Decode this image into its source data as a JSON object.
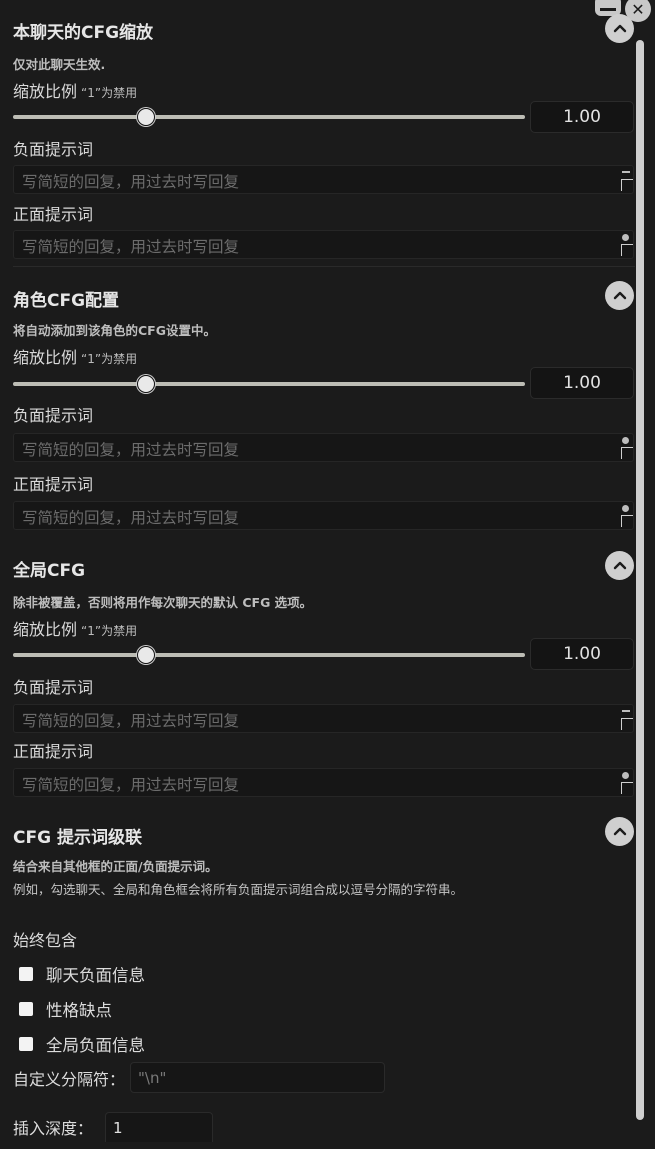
{
  "sections": [
    {
      "title": "本聊天的CFG缩放",
      "note": "仅对此聊天生效.",
      "scale_label": "缩放比例",
      "scale_hint": "“1”为禁用",
      "scale_value": "1.00",
      "scale_slider_fraction": 0.25,
      "negative_label": "负面提示词",
      "negative_placeholder": "写简短的回复，用过去时写回复",
      "positive_label": "正面提示词",
      "positive_placeholder": "写简短的回复，用过去时写回复"
    },
    {
      "title": "角色CFG配置",
      "note": "将自动添加到该角色的CFG设置中。",
      "scale_label": "缩放比例",
      "scale_hint": "“1”为禁用",
      "scale_value": "1.00",
      "scale_slider_fraction": 0.25,
      "negative_label": "负面提示词",
      "negative_placeholder": "写简短的回复，用过去时写回复",
      "positive_label": "正面提示词",
      "positive_placeholder": "写简短的回复，用过去时写回复"
    },
    {
      "title": "全局CFG",
      "note": "除非被覆盖，否则将用作每次聊天的默认 CFG 选项。",
      "scale_label": "缩放比例",
      "scale_hint": "“1”为禁用",
      "scale_value": "1.00",
      "scale_slider_fraction": 0.25,
      "negative_label": "负面提示词",
      "negative_placeholder": "写简短的回复，用过去时写回复",
      "positive_label": "正面提示词",
      "positive_placeholder": "写简短的回复，用过去时写回复"
    }
  ],
  "cascade": {
    "title": "CFG 提示词级联",
    "note1": "结合来自其他框的正面/负面提示词。",
    "note2": "例如，勾选聊天、全局和角色框会将所有负面提示词组合成以逗号分隔的字符串。",
    "always_include_label": "始终包含",
    "checkboxes": [
      {
        "label": "聊天负面信息",
        "checked": false
      },
      {
        "label": "性格缺点",
        "checked": false
      },
      {
        "label": "全局负面信息",
        "checked": false
      }
    ],
    "separator_label": "自定义分隔符：",
    "separator_placeholder": "\"\\n\"",
    "depth_label": "插入深度：",
    "depth_value": "1"
  }
}
